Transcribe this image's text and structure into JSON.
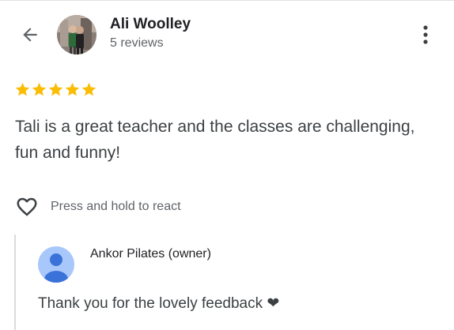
{
  "header": {
    "back_icon": "arrow-back-icon",
    "reviewer_name": "Ali Woolley",
    "reviewer_meta": "5 reviews",
    "more_icon": "more-vert-icon"
  },
  "review": {
    "rating": 5,
    "rating_max": 5,
    "star_color": "#fbbc04",
    "text": "Tali is a great teacher and the classes are challenging, fun and funny!"
  },
  "reaction": {
    "icon": "heart-outline-icon",
    "label": "Press and hold to react"
  },
  "owner_response": {
    "name": "Ankor Pilates (owner)",
    "avatar_color": "#a8c7fa",
    "avatar_figure_color": "#3b72d9",
    "reply": "Thank you for the lovely feedback ❤"
  }
}
